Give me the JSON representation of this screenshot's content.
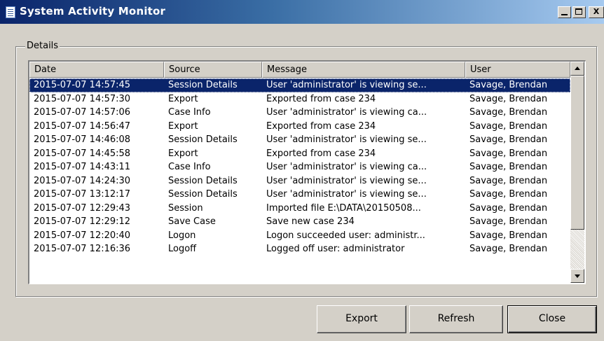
{
  "window": {
    "title": "System Activity Monitor"
  },
  "titlebar_buttons": {
    "minimize_icon": "minimize-icon",
    "maximize_icon": "maximize-icon",
    "close_glyph": "X"
  },
  "group": {
    "label": "Details"
  },
  "table": {
    "columns": [
      "Date",
      "Source",
      "Message",
      "User"
    ],
    "rows": [
      [
        "2015-07-07 14:57:45",
        "Session Details",
        "User 'administrator' is viewing se...",
        "Savage, Brendan"
      ],
      [
        "2015-07-07 14:57:30",
        "Export",
        "Exported from case 234",
        "Savage, Brendan"
      ],
      [
        "2015-07-07 14:57:06",
        "Case Info",
        "User 'administrator' is viewing ca...",
        "Savage, Brendan"
      ],
      [
        "2015-07-07 14:56:47",
        "Export",
        "Exported from case 234",
        "Savage, Brendan"
      ],
      [
        "2015-07-07 14:46:08",
        "Session Details",
        "User 'administrator' is viewing se...",
        "Savage, Brendan"
      ],
      [
        "2015-07-07 14:45:58",
        "Export",
        "Exported from case 234",
        "Savage, Brendan"
      ],
      [
        "2015-07-07 14:43:11",
        "Case Info",
        "User 'administrator' is viewing ca...",
        "Savage, Brendan"
      ],
      [
        "2015-07-07 14:24:30",
        "Session Details",
        "User 'administrator' is viewing se...",
        "Savage, Brendan"
      ],
      [
        "2015-07-07 13:12:17",
        "Session Details",
        "User 'administrator' is viewing se...",
        "Savage, Brendan"
      ],
      [
        "2015-07-07 12:29:43",
        "Session",
        "Imported file E:\\DATA\\20150508...",
        "Savage, Brendan"
      ],
      [
        "2015-07-07 12:29:12",
        "Save Case",
        "Save new case 234",
        "Savage, Brendan"
      ],
      [
        "2015-07-07 12:20:40",
        "Logon",
        "Logon succeeded user: administr...",
        "Savage, Brendan"
      ],
      [
        "2015-07-07 12:16:36",
        "Logoff",
        "Logged off user: administrator",
        "Savage, Brendan"
      ]
    ],
    "selected_row": 0
  },
  "buttons": {
    "export": "Export",
    "refresh": "Refresh",
    "close": "Close"
  },
  "colors": {
    "selection": "#0a246a",
    "window_bg": "#d4d0c8",
    "title_start": "#0a246a",
    "title_end": "#a6caf0"
  }
}
